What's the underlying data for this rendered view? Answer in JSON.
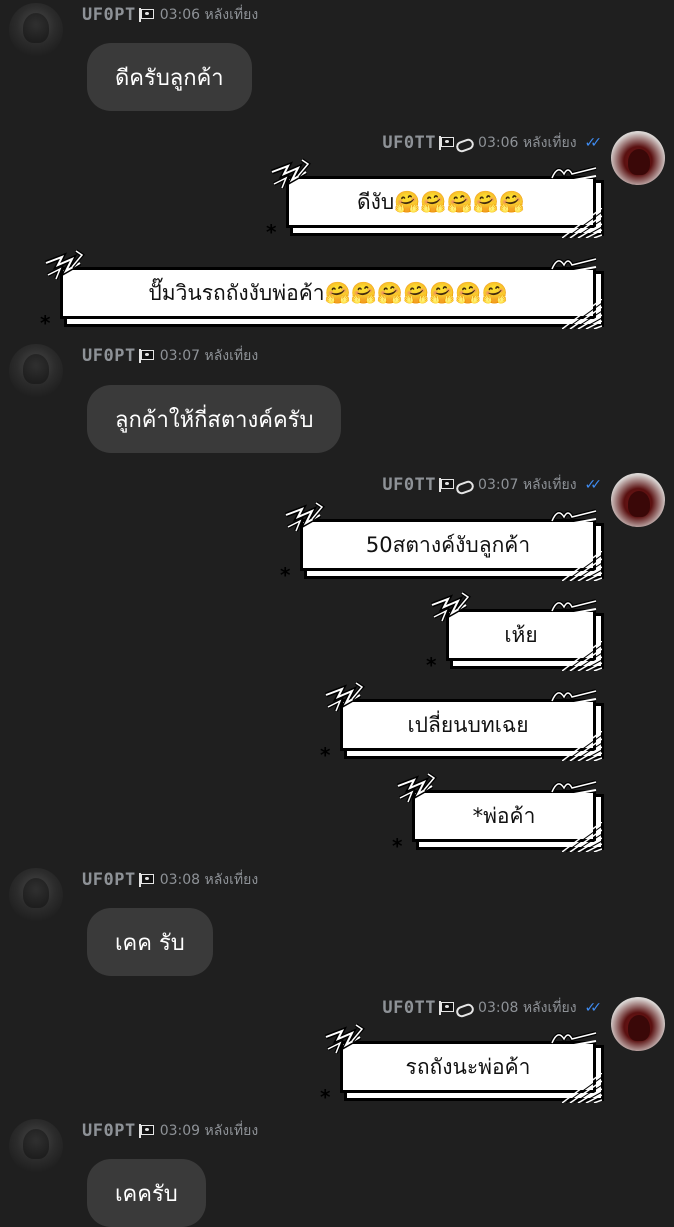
{
  "incoming_user": {
    "name": "UF0PT"
  },
  "outgoing_user": {
    "name": "UF0TT"
  },
  "messages": [
    {
      "time": "03:06 หลังเที่ยง",
      "text": "ดีครับลูกค้า"
    },
    {
      "time": "03:06 หลังเที่ยง",
      "check": "✓✓",
      "texts": [
        "ดีงับ🤗🤗🤗🤗🤗",
        "ปั๊มวินรถถังงับพ่อค้า🤗🤗🤗🤗🤗🤗🤗"
      ]
    },
    {
      "time": "03:07 หลังเที่ยง",
      "text": "ลูกค้าให้กี่สตางค์ครับ"
    },
    {
      "time": "03:07 หลังเที่ยง",
      "check": "✓✓",
      "texts": [
        "50สตางค์งับลูกค้า",
        "เห้ย",
        "เปลี่ยนบทเฉย",
        "*พ่อค้า"
      ]
    },
    {
      "time": "03:08 หลังเที่ยง",
      "text": "เคค รับ"
    },
    {
      "time": "03:08 หลังเที่ยง",
      "check": "✓✓",
      "texts": [
        "รถถังนะพ่อค้า"
      ]
    },
    {
      "time": "03:09 หลังเที่ยง",
      "text": "เคครับ"
    }
  ]
}
